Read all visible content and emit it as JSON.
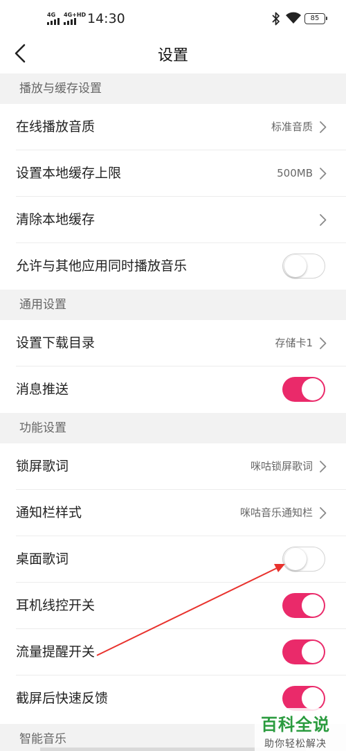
{
  "status_bar": {
    "signal_1": "4G",
    "signal_2": "4G+HD",
    "time": "14:30",
    "battery": "85",
    "icons": [
      "bluetooth-icon",
      "wifi-icon",
      "battery-icon"
    ]
  },
  "nav": {
    "title": "设置",
    "back_icon": "chevron-left-icon"
  },
  "sections": {
    "playback": {
      "header": "播放与缓存设置",
      "online_quality": {
        "label": "在线播放音质",
        "value": "标准音质"
      },
      "cache_limit": {
        "label": "设置本地缓存上限",
        "value": "500MB"
      },
      "clear_cache": {
        "label": "清除本地缓存"
      },
      "allow_concurrent": {
        "label": "允许与其他应用同时播放音乐",
        "enabled": false
      }
    },
    "general": {
      "header": "通用设置",
      "download_dir": {
        "label": "设置下载目录",
        "value": "存储卡1"
      },
      "push": {
        "label": "消息推送",
        "enabled": true
      }
    },
    "features": {
      "header": "功能设置",
      "lock_lyrics": {
        "label": "锁屏歌词",
        "value": "咪咕锁屏歌词"
      },
      "notification_style": {
        "label": "通知栏样式",
        "value": "咪咕音乐通知栏"
      },
      "desktop_lyrics": {
        "label": "桌面歌词",
        "enabled": false
      },
      "headset_control": {
        "label": "耳机线控开关",
        "enabled": true
      },
      "data_alert": {
        "label": "流量提醒开关",
        "enabled": true
      },
      "screenshot_feedback": {
        "label": "截屏后快速反馈",
        "enabled": true
      }
    },
    "smart": {
      "header": "智能音乐"
    }
  },
  "colors": {
    "toggle_on": "#ea2a6a",
    "section_bg": "#f2f2f2",
    "annotation_arrow": "#e8322d",
    "watermark": "#2a9b3e"
  },
  "watermark": {
    "main": "百科全说",
    "sub": "助你轻松解决"
  }
}
